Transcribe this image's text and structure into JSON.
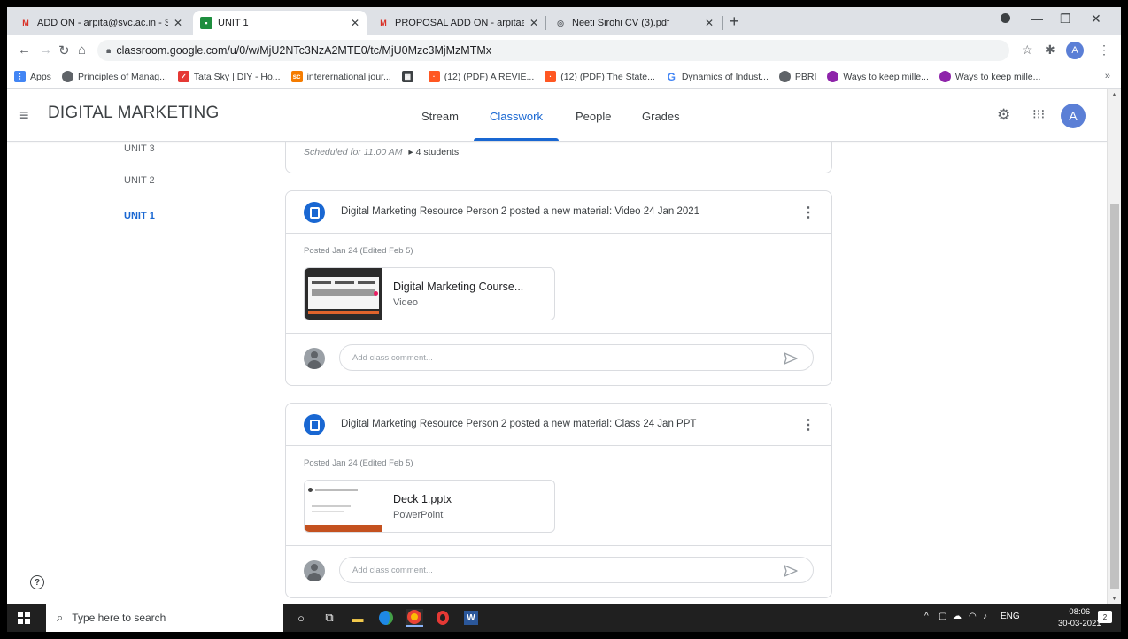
{
  "browser": {
    "tabs": [
      {
        "title": "ADD ON - arpita@svc.ac.in - Sri \\",
        "favicon": "gmail-icon",
        "color": "#d93025"
      },
      {
        "title": "UNIT 1",
        "favicon": "classroom-icon",
        "color": "#1e8e3e"
      },
      {
        "title": "PROPOSAL ADD ON - arpitaaa@",
        "favicon": "gmail-icon",
        "color": "#d93025"
      },
      {
        "title": "Neeti Sirohi CV (3).pdf",
        "favicon": "globe-icon",
        "color": "#5f6368"
      }
    ],
    "url": "classroom.google.com/u/0/w/MjU2NTc3NzA2MTE0/tc/MjU0Mzc3MjMzMTMx",
    "profile_initial": "A",
    "bookmarks": [
      {
        "label": "Apps",
        "color": "#4285f4"
      },
      {
        "label": "Principles of Manag...",
        "color": "#5f6368"
      },
      {
        "label": "Tata Sky | DIY - Ho...",
        "color": "#e53935"
      },
      {
        "label": "interernational jour...",
        "color": "#f57c00"
      },
      {
        "label": "",
        "color": "#3c4043"
      },
      {
        "label": "(12) (PDF) A REVIE...",
        "color": "#ff5722"
      },
      {
        "label": "(12) (PDF) The State...",
        "color": "#ff5722"
      },
      {
        "label": "Dynamics of Indust...",
        "color": "#4285f4"
      },
      {
        "label": "PBRI",
        "color": "#5f6368"
      },
      {
        "label": "Ways to keep mille...",
        "color": "#8e24aa"
      },
      {
        "label": "Ways to keep mille...",
        "color": "#8e24aa"
      }
    ],
    "bookmarks_more": "»"
  },
  "header": {
    "class_name": "DIGITAL MARKETING",
    "tabs": [
      "Stream",
      "Classwork",
      "People",
      "Grades"
    ],
    "active_tab": "Classwork",
    "avatar_initial": "A",
    "accent": "#1967d2"
  },
  "sidebar": {
    "units": [
      "UNIT 3",
      "UNIT 2",
      "UNIT 1"
    ],
    "active": "UNIT 1"
  },
  "top_card": {
    "scheduled": "Scheduled for 11:00 AM",
    "students": "4 students"
  },
  "posts": [
    {
      "header": "Digital Marketing Resource Person 2 posted a new material: Video 24 Jan 2021",
      "posted": "Posted Jan 24 (Edited Feb 5)",
      "attachment_title": "Digital Marketing Course...",
      "attachment_type": "Video",
      "comment_placeholder": "Add class comment..."
    },
    {
      "header": "Digital Marketing Resource Person 2 posted a new material: Class 24 Jan PPT",
      "posted": "Posted Jan 24 (Edited Feb 5)",
      "attachment_title": "Deck 1.pptx",
      "attachment_type": "PowerPoint",
      "comment_placeholder": "Add class comment..."
    }
  ],
  "taskbar": {
    "search_placeholder": "Type here to search",
    "language": "ENG",
    "time": "08:06",
    "date": "30-03-2021",
    "notification_count": "2"
  }
}
